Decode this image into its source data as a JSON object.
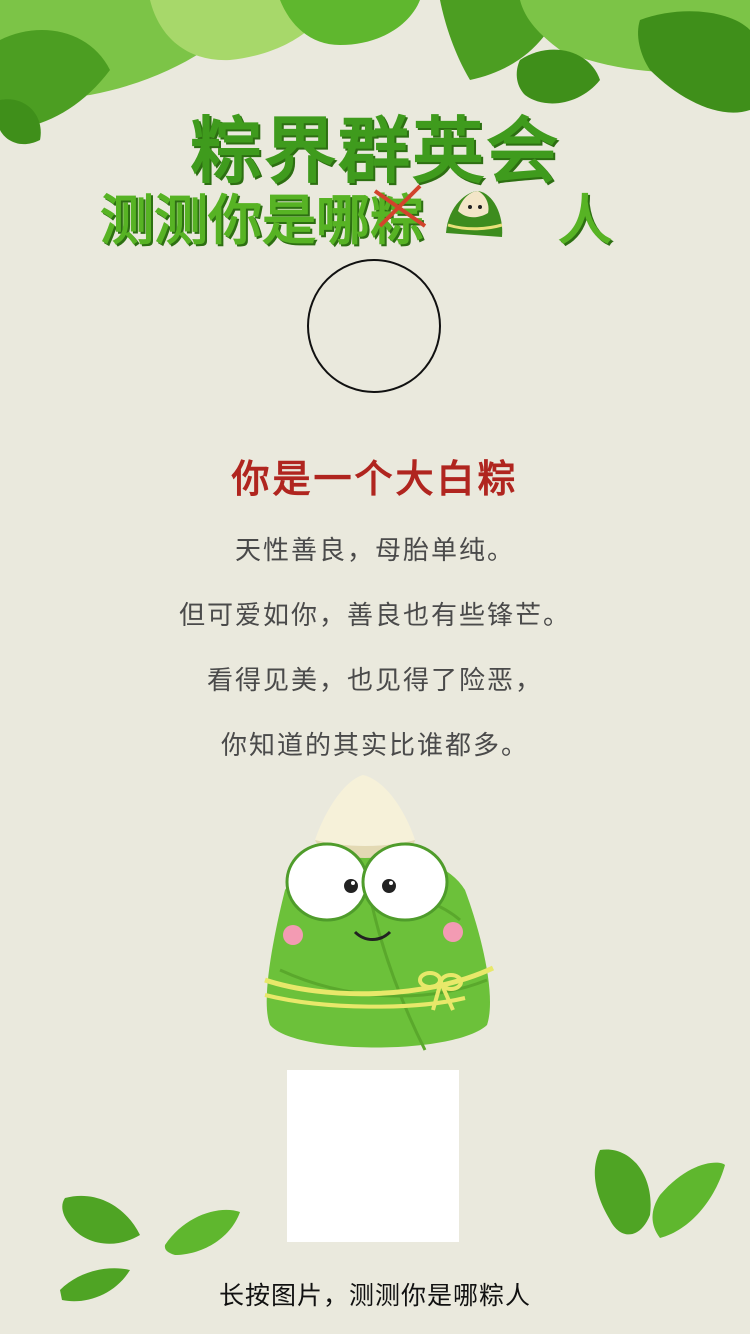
{
  "header": {
    "title": "粽界群英会",
    "subtitle_prefix": "测测你是哪",
    "subtitle_struck": "粽",
    "subtitle_suffix": "人"
  },
  "result": {
    "title": "你是一个大白粽",
    "lines": [
      "天性善良，母胎单纯。",
      "但可爱如你，善良也有些锋芒。",
      "看得见美，也见得了险恶，",
      "你知道的其实比谁都多。"
    ]
  },
  "footer": {
    "hint": "长按图片，测测你是哪粽人"
  },
  "icons": {
    "zongzi_small": "zongzi-mascot-icon",
    "zongzi_large": "zongzi-character-illustration"
  },
  "colors": {
    "background": "#eae9dd",
    "title_green": "#3f9b1d",
    "result_red": "#b0251f",
    "leaf_green": "#5fb72e"
  }
}
